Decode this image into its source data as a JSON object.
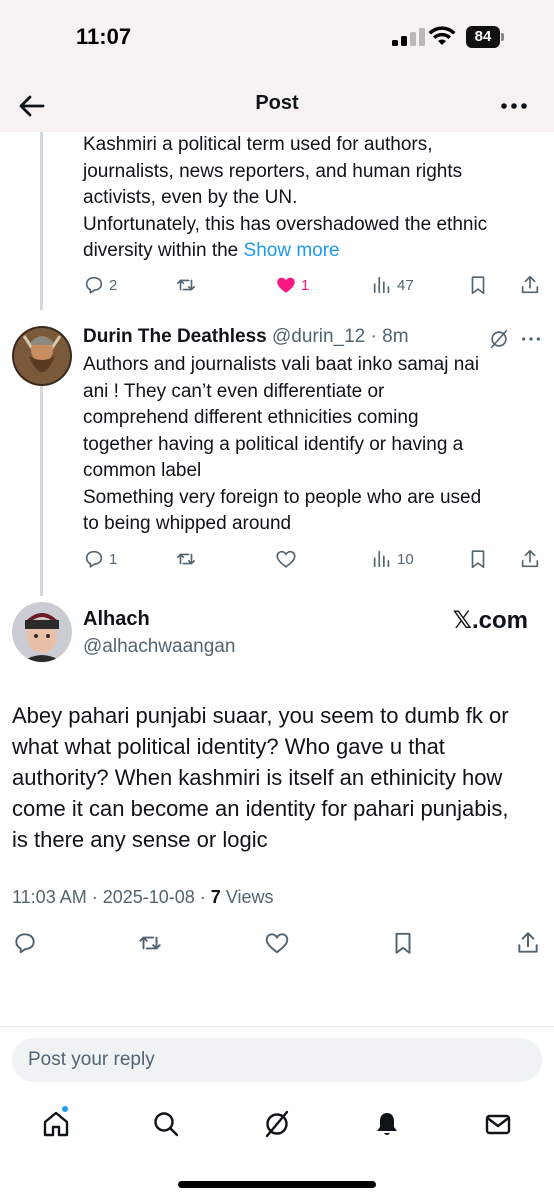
{
  "status_bar": {
    "time": "11:07",
    "battery": "84"
  },
  "header": {
    "title": "Post"
  },
  "parent_tweet": {
    "text_lines": [
      "Kashmiri a political term used for authors,",
      "journalists, news reporters, and human rights",
      "activists, even by the UN.",
      "Unfortunately, this has overshadowed the ethnic"
    ],
    "last_line": "diversity within the ",
    "show_more": "Show more",
    "replies": "2",
    "likes": "1",
    "views": "47",
    "like_color": "#f91880"
  },
  "reply_tweet": {
    "name": "Durin The Deathless",
    "handle": "@durin_12",
    "separator": " · ",
    "time": "8m",
    "text_lines": [
      "Authors and journalists vali baat inko samaj nai",
      "ani ! They can’t even differentiate or",
      "comprehend different ethnicities coming",
      "together having a political identify or having a",
      "common label",
      "Something very foreign to people who are used",
      "to being whipped around"
    ],
    "replies": "1",
    "views": "10"
  },
  "main_tweet": {
    "name": "Alhach",
    "handle": "@alhachwaangan",
    "watermark": "𝕏.com",
    "text_lines": [
      "Abey pahari punjabi suaar, you seem to dumb fk or",
      "what what political identity? Who gave u that",
      "authority? When kashmiri is itself an ethinicity how",
      "come it can become an identity for pahari punjabis,",
      "is there any sense or logic"
    ],
    "timestamp": "11:03 AM · 2025-10-08 · ",
    "views_count": "7",
    "views_label": " Views"
  },
  "reply_box": {
    "placeholder": "Post your reply"
  },
  "tabbar": {
    "items": [
      "home-icon",
      "search-icon",
      "grok-icon",
      "notifications-icon",
      "messages-icon"
    ]
  },
  "colors": {
    "accent": "#1d9bf0",
    "muted": "#536471",
    "text": "#0f1419"
  }
}
